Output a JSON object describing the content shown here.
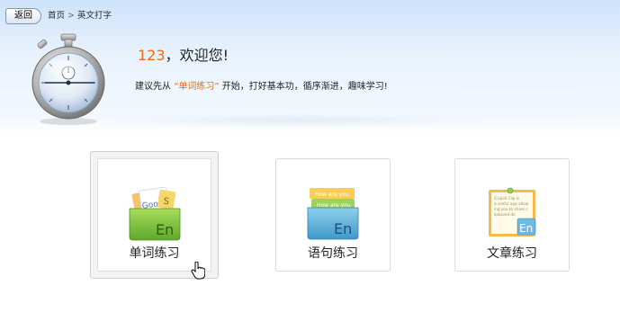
{
  "nav": {
    "back_label": "返回",
    "breadcrumb_home": "首页",
    "breadcrumb_sep": ">",
    "breadcrumb_current": "英文打字"
  },
  "welcome": {
    "username": "123",
    "comma": "，",
    "greeting": "欢迎您!"
  },
  "suggestion": {
    "prefix": "建议先从",
    "highlight": "“单词练习”",
    "suffix": "开始，打好基本功，循序渐进，趣味学习!"
  },
  "cards": [
    {
      "label": "单词练习",
      "icon": "word-practice-icon",
      "selected": true
    },
    {
      "label": "语句练习",
      "icon": "sentence-practice-icon",
      "selected": false
    },
    {
      "label": "文章练习",
      "icon": "article-practice-icon",
      "selected": false
    }
  ],
  "icon_text": {
    "good": "Good",
    "s": "S",
    "en": "En",
    "note1": "How are you",
    "note2": "How are you",
    "clip_lines": [
      "iCopoll Clip is",
      "a useful app allow",
      "ing you to share c",
      "lipboard de"
    ]
  },
  "colors": {
    "accent": "#f06a0f",
    "header_gradient_top": "#cfe3fb"
  }
}
